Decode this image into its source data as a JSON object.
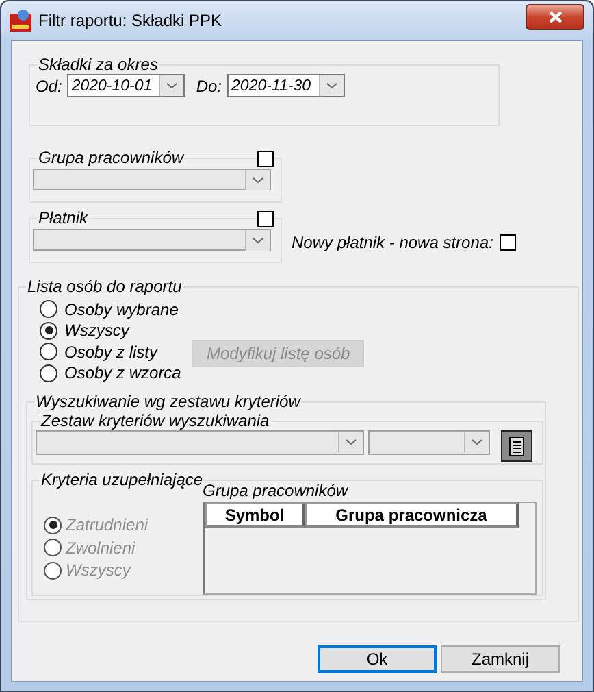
{
  "window": {
    "title": "Filtr raportu: Składki PPK"
  },
  "period": {
    "legend": "Składki za okres",
    "from_label": "Od:",
    "from_value": "2020-10-01",
    "to_label": "Do:",
    "to_value": "2020-11-30"
  },
  "employee_group": {
    "legend": "Grupa pracowników",
    "checked": false
  },
  "payer": {
    "legend": "Płatnik",
    "checked": false
  },
  "new_page": {
    "label": "Nowy płatnik - nowa strona:",
    "checked": false
  },
  "people_list": {
    "legend": "Lista osób do raportu",
    "options": [
      {
        "label": "Osoby wybrane",
        "selected": false
      },
      {
        "label": "Wszyscy",
        "selected": true
      },
      {
        "label": "Osoby z listy",
        "selected": false
      },
      {
        "label": "Osoby z wzorca",
        "selected": false
      }
    ],
    "modify_button": {
      "label": "Modyfikuj listę osób",
      "disabled": true
    }
  },
  "search": {
    "legend": "Wyszukiwanie wg zestawu kryteriów",
    "criteria_set": {
      "legend": "Zestaw kryteriów wyszukiwania"
    },
    "supplementary": {
      "legend": "Kryteria uzupełniające",
      "disabled": true,
      "options": [
        {
          "label": "Zatrudnieni",
          "selected": true
        },
        {
          "label": "Zwolnieni",
          "selected": false
        },
        {
          "label": "Wszyscy",
          "selected": false
        }
      ],
      "group_label": "Grupa pracowników",
      "columns": [
        "Symbol",
        "Grupa pracownicza"
      ]
    }
  },
  "buttons": [
    {
      "label": "Ok",
      "focused": true
    },
    {
      "label": "Zamknij",
      "focused": false
    }
  ]
}
